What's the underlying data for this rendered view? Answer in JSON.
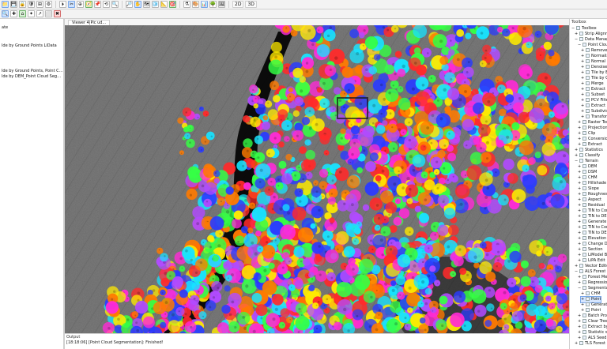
{
  "top_toolbar": {
    "row1": [
      "📁",
      "💾",
      "🔒",
      "🛡",
      "⊞",
      "⚙",
      "⏵",
      "✂",
      "⊕",
      "🧭",
      "📌",
      "⟲",
      "🔍",
      "🔎",
      "✋",
      "🗺",
      "🧊",
      "📐",
      "🎯",
      "⚗",
      "🎨",
      "📊",
      "🌳",
      "🖼"
    ],
    "row2": [
      "🔍",
      "✚",
      "⌂",
      "✦",
      "↗",
      "⬜",
      "✖"
    ],
    "toggle_2d": "2D",
    "toggle_3d": "3D"
  },
  "left_panel": {
    "rows": [
      {
        "text": "ate",
        "y": 31
      },
      {
        "text": "lde by Ground Points LiData",
        "y": 54
      },
      {
        "text": "lde by Ground Points, Point Cloud Segmen",
        "y": 86
      },
      {
        "text": "lde by DEM_Point Cloud Segmentation.L",
        "y": 93
      }
    ]
  },
  "viewer": {
    "tab_label": "Viewer 4|Pic ud...",
    "output_title": "Output",
    "output_line": "[18:18:06] [Point Cloud Segmentation]: Finished!"
  },
  "right_panel": {
    "title": "Toolbox",
    "items": [
      {
        "label": "Toolbox",
        "indent": 0,
        "expanded": true
      },
      {
        "label": "Strip Alignment",
        "indent": 1
      },
      {
        "label": "Data Management",
        "indent": 1,
        "expanded": true
      },
      {
        "label": "Point Cloud",
        "indent": 2,
        "expanded": true
      },
      {
        "label": "Remove",
        "indent": 3
      },
      {
        "label": "Normalize",
        "indent": 3
      },
      {
        "label": "Normal",
        "indent": 3
      },
      {
        "label": "Denoise",
        "indent": 3
      },
      {
        "label": "Tile by Extent",
        "indent": 3
      },
      {
        "label": "Tile by Count",
        "indent": 3
      },
      {
        "label": "Merge",
        "indent": 3
      },
      {
        "label": "Extract",
        "indent": 3
      },
      {
        "label": "Subset",
        "indent": 3
      },
      {
        "label": "PCV Filter",
        "indent": 3
      },
      {
        "label": "Extract",
        "indent": 3
      },
      {
        "label": "Subdivide",
        "indent": 3
      },
      {
        "label": "Transform",
        "indent": 3
      },
      {
        "label": "Raster Tools",
        "indent": 2
      },
      {
        "label": "Projection",
        "indent": 2
      },
      {
        "label": "Clip",
        "indent": 2
      },
      {
        "label": "Conversion",
        "indent": 2
      },
      {
        "label": "Extract",
        "indent": 2
      },
      {
        "label": "Statistics",
        "indent": 1
      },
      {
        "label": "Classify",
        "indent": 1
      },
      {
        "label": "Terrain",
        "indent": 1,
        "expanded": true
      },
      {
        "label": "DEM",
        "indent": 2
      },
      {
        "label": "DSM",
        "indent": 2
      },
      {
        "label": "CHM",
        "indent": 2
      },
      {
        "label": "Hillshade",
        "indent": 2
      },
      {
        "label": "Slope",
        "indent": 2
      },
      {
        "label": "Roughness",
        "indent": 2
      },
      {
        "label": "Aspect",
        "indent": 2
      },
      {
        "label": "Residual",
        "indent": 2
      },
      {
        "label": "TIN to Contour",
        "indent": 2
      },
      {
        "label": "TIN to DEM",
        "indent": 2
      },
      {
        "label": "Generate",
        "indent": 2
      },
      {
        "label": "TIN to Cont",
        "indent": 2
      },
      {
        "label": "TIN to DEM",
        "indent": 2
      },
      {
        "label": "Elevation",
        "indent": 2
      },
      {
        "label": "Change Det",
        "indent": 2
      },
      {
        "label": "Section",
        "indent": 2
      },
      {
        "label": "LiModel Bu",
        "indent": 2
      },
      {
        "label": "LiPA Edit",
        "indent": 2
      },
      {
        "label": "Vector Editor",
        "indent": 1
      },
      {
        "label": "ALS Forest",
        "indent": 1,
        "expanded": true
      },
      {
        "label": "Forest Metrics",
        "indent": 2
      },
      {
        "label": "Regression",
        "indent": 2
      },
      {
        "label": "Segmentation",
        "indent": 2,
        "expanded": true
      },
      {
        "label": "CHM",
        "indent": 3
      },
      {
        "label": "Point",
        "indent": 3,
        "selected": true
      },
      {
        "label": "Generate",
        "indent": 3
      },
      {
        "label": "Point",
        "indent": 3
      },
      {
        "label": "Batch Process",
        "indent": 2
      },
      {
        "label": "Clear Tree",
        "indent": 2
      },
      {
        "label": "Extract by",
        "indent": 2
      },
      {
        "label": "Statistic w",
        "indent": 2
      },
      {
        "label": "ALS Seed E",
        "indent": 2
      },
      {
        "label": "TLS Forest",
        "indent": 1
      }
    ]
  },
  "colors": {
    "accent": "#2f6fd1",
    "tree_palette": [
      "#ff2a2a",
      "#2a3bff",
      "#17e3ff",
      "#35ff45",
      "#ffea00",
      "#ff2ad6",
      "#b14bff",
      "#ff7a00",
      "#1a1a1a",
      "#ffffff"
    ]
  }
}
